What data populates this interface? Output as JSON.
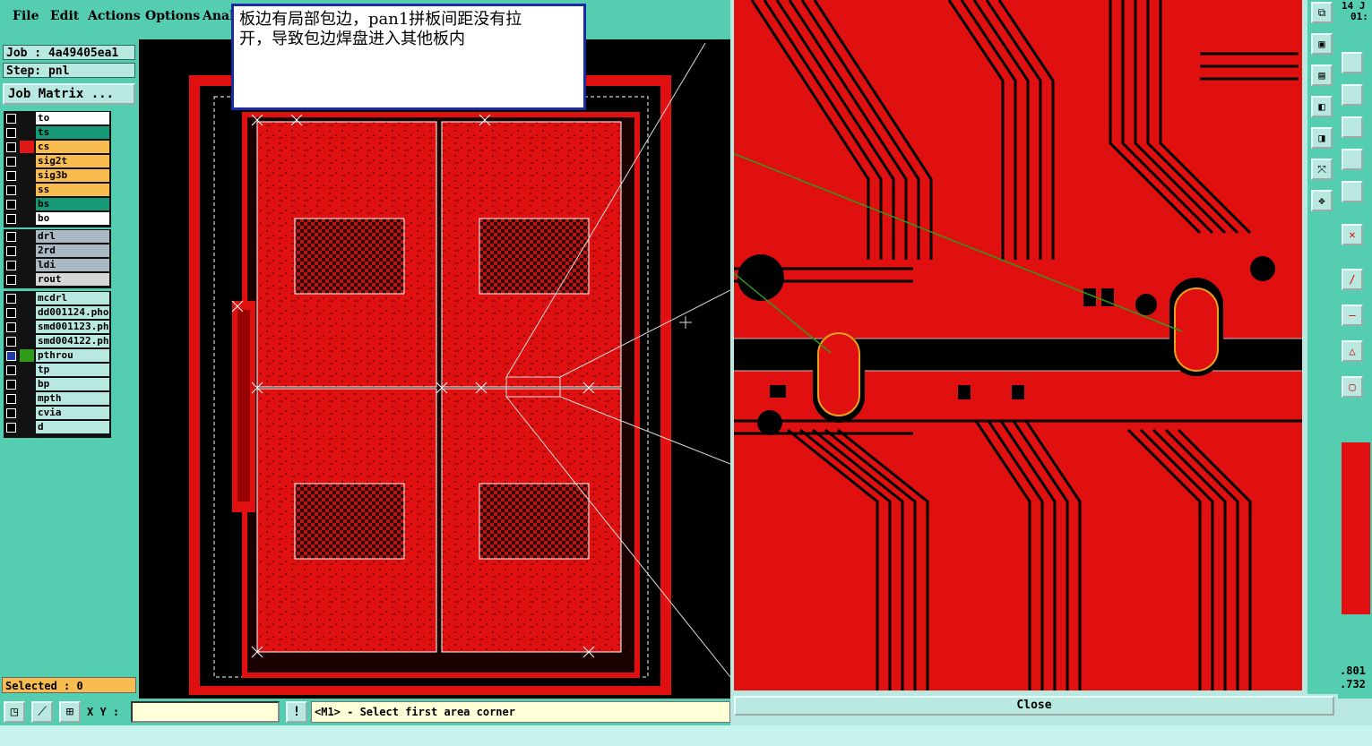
{
  "menu": {
    "file": "File",
    "edit": "Edit",
    "actions": "Actions",
    "options": "Options",
    "analysis": "Anal"
  },
  "job": {
    "job_line": "Job : 4a49405ea1",
    "step_line": "Step: pnl",
    "matrix_button": "Job Matrix ..."
  },
  "layers": {
    "group1": [
      {
        "name": "to",
        "color": "#ffffff",
        "mark": "",
        "checked": false
      },
      {
        "name": "ts",
        "color": "#189a78",
        "mark": "",
        "checked": false
      },
      {
        "name": "cs",
        "color": "#f9bd4f",
        "mark": "#e01818",
        "checked": false
      },
      {
        "name": "sig2t",
        "color": "#f9bd4f",
        "mark": "",
        "checked": false
      },
      {
        "name": "sig3b",
        "color": "#f9bd4f",
        "mark": "",
        "checked": false
      },
      {
        "name": "ss",
        "color": "#f9bd4f",
        "mark": "",
        "checked": false
      },
      {
        "name": "bs",
        "color": "#189a78",
        "mark": "",
        "checked": false
      },
      {
        "name": "bo",
        "color": "#ffffff",
        "mark": "",
        "checked": false
      }
    ],
    "group2": [
      {
        "name": "drl",
        "color": "#a9b8c2",
        "mark": "",
        "checked": false
      },
      {
        "name": "2rd",
        "color": "#a9b8c2",
        "mark": "",
        "checked": false
      },
      {
        "name": "ldi",
        "color": "#a9b8c2",
        "mark": "",
        "checked": false
      },
      {
        "name": "rout",
        "color": "#d6d6d6",
        "mark": "",
        "checked": false
      }
    ],
    "group3": [
      {
        "name": "mcdrl",
        "color": "#b8e8e0",
        "mark": "",
        "checked": false
      },
      {
        "name": "dd001124.pho",
        "color": "#b8e8e0",
        "mark": "",
        "checked": false
      },
      {
        "name": "smd001123.ph",
        "color": "#b8e8e0",
        "mark": "",
        "checked": false
      },
      {
        "name": "smd004122.ph",
        "color": "#b8e8e0",
        "mark": "",
        "checked": false
      },
      {
        "name": "pthrou",
        "color": "#b8e8e0",
        "mark": "#2f9a1c",
        "checked": true
      },
      {
        "name": "tp",
        "color": "#b8e8e0",
        "mark": "",
        "checked": false
      },
      {
        "name": "bp",
        "color": "#b8e8e0",
        "mark": "",
        "checked": false
      },
      {
        "name": "mpth",
        "color": "#b8e8e0",
        "mark": "",
        "checked": false
      },
      {
        "name": "cvia",
        "color": "#b8e8e0",
        "mark": "",
        "checked": false
      },
      {
        "name": "d",
        "color": "#b8e8e0",
        "mark": "",
        "checked": false
      }
    ]
  },
  "selection": {
    "text": "Selected : 0"
  },
  "annotation": {
    "line1": "板边有局部包边，pan1拼板间距没有拉",
    "line2": "开，导致包边焊盘进入其他板内"
  },
  "zoom": {
    "close_label": "Close"
  },
  "status": {
    "xy_label": "X Y :",
    "xy_value": "",
    "prompt": "<M1> - Select first area corner"
  },
  "side_readouts": {
    "top1": "14 J",
    "top2": "01:",
    "val1": ".801",
    "val2": ".732"
  },
  "colors": {
    "copper": "#e01010",
    "background": "#000000",
    "panel": "#55cdb0",
    "field": "#b8e8e0"
  }
}
